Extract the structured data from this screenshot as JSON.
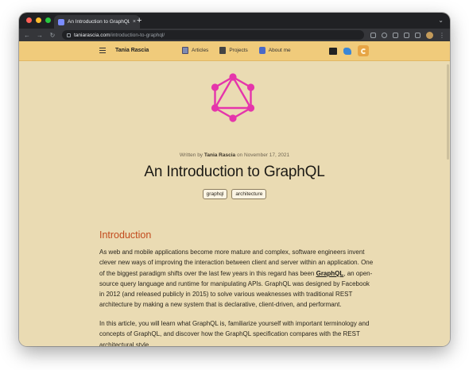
{
  "browser": {
    "tab_title": "An Introduction to GraphQL | T",
    "tab_close": "×",
    "new_tab": "+",
    "tab_search": "⌄",
    "back": "←",
    "forward": "→",
    "reload": "↻",
    "url_host": "taniarascia.com",
    "url_path": "/introduction-to-graphql/",
    "menu": "⋮",
    "icons": [
      "share-icon",
      "bookmark-star-icon",
      "extensions-icon",
      "reading-list-icon",
      "side-panel-icon",
      "profile-avatar-icon"
    ]
  },
  "site_nav": {
    "brand": "Tania Rascia",
    "links": [
      {
        "label": "Articles",
        "icon": "articles-icon"
      },
      {
        "label": "Projects",
        "icon": "projects-icon"
      },
      {
        "label": "About me",
        "icon": "about-me-icon"
      }
    ],
    "right_icons": [
      "rss-icon",
      "bluesky-icon",
      "theme-toggle-icon"
    ],
    "colors": {
      "background": "#f0cb7b",
      "toggle": "#e7a545"
    }
  },
  "article": {
    "meta_prefix": "Written by ",
    "author": "Tania Rascia",
    "meta_mid": " on ",
    "date": "November 17, 2021",
    "title": "An Introduction to GraphQL",
    "tags": [
      "graphql",
      "architecture"
    ],
    "section_heading": "Introduction",
    "p1_before_link": "As web and mobile applications become more mature and complex, software engineers invent clever new ways of improving the interaction between client and server within an application. One of the biggest paradigm shifts over the last few years in this regard has been ",
    "p1_link": "GraphQL",
    "p1_after_link": ", an open-source query language and runtime for manipulating APIs. GraphQL was designed by Facebook in 2012 (and released publicly in 2015) to solve various weaknesses with traditional REST architecture by making a new system that is declarative, client-driven, and performant.",
    "p2": "In this article, you will learn what GraphQL is, familiarize yourself with important terminology and concepts of GraphQL, and discover how the GraphQL specification compares with the REST architectural style.",
    "colors": {
      "background": "#eadbb3",
      "heading": "#c24a1d",
      "logo": "#e535ab"
    }
  }
}
